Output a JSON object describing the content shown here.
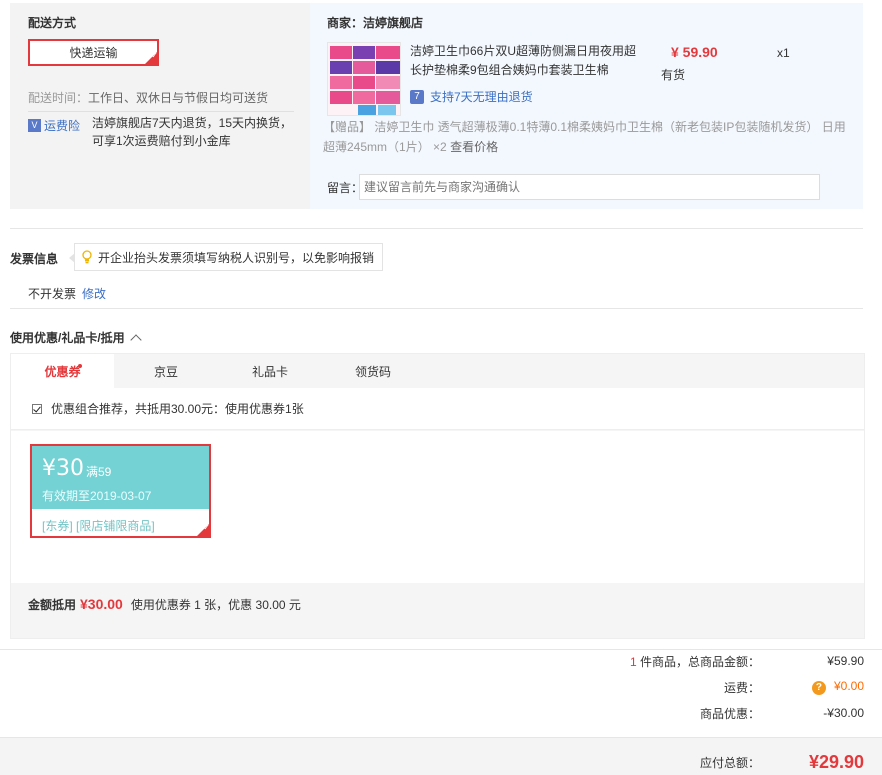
{
  "shipping": {
    "title": "配送方式",
    "method": "快递运输",
    "time_label": "配送时间：",
    "time_value": "工作日、双休日与节假日均可送货",
    "insurance_badge": "V",
    "insurance_label": "运费险",
    "insurance_text": "洁婷旗舰店7天内退货，15天内换货，可享1次运费赔付到小金库"
  },
  "shop": {
    "label": "商家：洁婷旗舰店",
    "product": {
      "title": "洁婷卫生巾66片双U超薄防侧漏日用夜用超长护垫棉柔9包组合姨妈巾套装卫生棉",
      "price": "¥ 59.90",
      "stock": "有货",
      "qty": "x1",
      "return_icon": "7",
      "return_text": "支持7天无理由退货"
    },
    "gift_text": "【赠品】 洁婷卫生巾 透气超薄极薄0.1特薄0.1棉柔姨妈巾卫生棉（新老包装IP包装随机发货） 日用超薄245mm（1片） ×2",
    "gift_view": "查看价格",
    "message_label": "留言：",
    "message_placeholder": "建议留言前先与商家沟通确认"
  },
  "invoice": {
    "title": "发票信息",
    "tip": "开企业抬头发票须填写纳税人识别号，以免影响报销",
    "status": "不开发票",
    "edit": "修改"
  },
  "coupons": {
    "title": "使用优惠/礼品卡/抵用",
    "tabs": [
      "优惠券",
      "京豆",
      "礼品卡",
      "领货码"
    ],
    "combo_text": "优惠组合推荐，共抵用30.00元：使用优惠券1张",
    "card": {
      "amount": "¥30",
      "condition": "满59",
      "expiry": "有效期至2019-03-07",
      "tags": "[东券] [限店铺限商品]"
    },
    "summary_label": "金额抵用",
    "summary_amount": "¥30.00",
    "summary_text": "使用优惠券 1 张，优惠 30.00 元"
  },
  "totals": {
    "count": "1",
    "count_suffix": " 件商品，总商品金额：",
    "goods_amount": "¥59.90",
    "freight_label": "运费：",
    "freight_icon": "?",
    "freight_value": "¥0.00",
    "discount_label": "商品优惠：",
    "discount_value": "-¥30.00",
    "payable_label": "应付总额：",
    "payable_value": "¥29.90"
  }
}
